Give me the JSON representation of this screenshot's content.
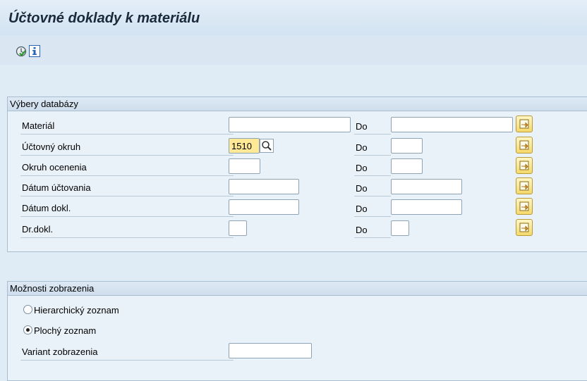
{
  "app": {
    "title": "Účtovné doklady k materiálu"
  },
  "toolbar": {
    "execute_icon": "execute-icon",
    "info_icon": "info-icon"
  },
  "selections": {
    "group_title": "Výbery databázy",
    "to_label": "Do",
    "rows": [
      {
        "label": "Materiál",
        "from_value": "",
        "to_value": ""
      },
      {
        "label": "Účtovný okruh",
        "from_value": "1510",
        "to_value": ""
      },
      {
        "label": "Okruh ocenenia",
        "from_value": "",
        "to_value": ""
      },
      {
        "label": "Dátum účtovania",
        "from_value": "",
        "to_value": ""
      },
      {
        "label": "Dátum dokl.",
        "from_value": "",
        "to_value": ""
      },
      {
        "label": "Dr.dokl.",
        "from_value": "",
        "to_value": ""
      }
    ]
  },
  "display": {
    "group_title": "Možnosti zobrazenia",
    "options": [
      {
        "label": "Hierarchický zoznam",
        "selected": false
      },
      {
        "label": "Plochý zoznam",
        "selected": true
      }
    ],
    "variant_label": "Variant zobrazenia",
    "variant_value": ""
  },
  "colors": {
    "active_field": "#ffe896",
    "multi_select_button": "#f6d96b"
  }
}
